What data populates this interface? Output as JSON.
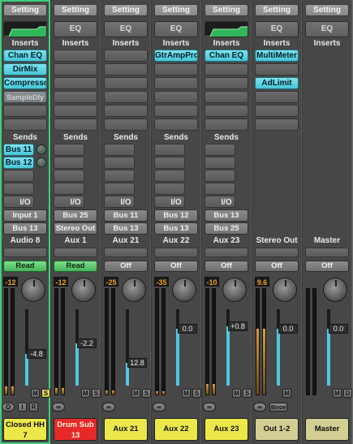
{
  "colors": {
    "accent_cyan": "#47c6d8",
    "read_green": "#49b35a",
    "selected_outline": "#3fd07a",
    "plate_yellow": "#ede84a",
    "plate_red": "#e62a2a",
    "plate_olive": "#d3cf94",
    "peak_orange": "#f0a020"
  },
  "section_labels": {
    "inserts": "Inserts",
    "sends": "Sends",
    "io": "I/O"
  },
  "strips": [
    {
      "setting": "Setting",
      "eq": "",
      "eq_visual": "curve",
      "inserts": [
        "Chan EQ",
        "DirMix",
        "Compresso",
        "SampleDly",
        "",
        ""
      ],
      "insert_states": [
        "on",
        "on",
        "on",
        "off",
        "empty",
        "empty"
      ],
      "sends": [
        "Bus 11",
        "Bus 12",
        "",
        "",
        ""
      ],
      "io_input": "Input 1",
      "io_output": "Bus 13",
      "track_label": "Audio 8",
      "automation": "Read",
      "peak": "-12",
      "fader_value": "-4.8",
      "fader_level": 0.42,
      "meter_level": 0.08,
      "buttons": [
        "M",
        "S"
      ],
      "bottom_buttons": [
        "O",
        "I",
        "R"
      ],
      "name_line1": "Closed HH",
      "name_line2": "7",
      "name_color": "yellow"
    },
    {
      "setting": "Setting",
      "eq": "EQ",
      "eq_visual": "empty",
      "inserts": [
        "",
        "",
        "",
        "",
        "",
        ""
      ],
      "insert_states": [
        "empty",
        "empty",
        "empty",
        "empty",
        "empty",
        "empty"
      ],
      "sends": [
        "",
        "",
        "",
        "",
        ""
      ],
      "io_input": "Bus 25",
      "io_output": "Stereo Out",
      "track_label": "Aux 1",
      "automation": "Read",
      "peak": "-12",
      "fader_value": "-2.2",
      "fader_level": 0.55,
      "meter_level": 0.06,
      "buttons": [
        "M",
        "S"
      ],
      "bottom_buttons": [
        "link"
      ],
      "name_line1": "Drum Sub",
      "name_line2": "13",
      "name_color": "red"
    },
    {
      "setting": "Setting",
      "eq": "EQ",
      "eq_visual": "empty",
      "inserts": [
        "",
        "",
        "",
        "",
        "",
        ""
      ],
      "insert_states": [
        "empty",
        "empty",
        "empty",
        "empty",
        "empty",
        "empty"
      ],
      "sends": [
        "",
        "",
        "",
        "",
        ""
      ],
      "io_input": "Bus 11",
      "io_output": "Bus 13",
      "track_label": "Aux 21",
      "automation": "Off",
      "peak": "-25",
      "fader_value": "12.8",
      "fader_level": 0.3,
      "meter_level": 0.04,
      "buttons": [
        "M",
        "S"
      ],
      "bottom_buttons": [
        "link"
      ],
      "name_line1": "Aux 21",
      "name_line2": "",
      "name_color": "yellow"
    },
    {
      "setting": "Setting",
      "eq": "EQ",
      "eq_visual": "empty",
      "inserts": [
        "GtrAmpPro",
        "",
        "",
        "",
        "",
        ""
      ],
      "insert_states": [
        "on",
        "empty",
        "empty",
        "empty",
        "empty",
        "empty"
      ],
      "sends": [
        "",
        "",
        "",
        "",
        ""
      ],
      "io_input": "Bus 12",
      "io_output": "Bus 13",
      "track_label": "Aux 22",
      "automation": "Off",
      "peak": "-35",
      "fader_value": "0.0",
      "fader_level": 0.75,
      "meter_level": 0.03,
      "buttons": [
        "M",
        "S"
      ],
      "bottom_buttons": [
        "link"
      ],
      "name_line1": "Aux 22",
      "name_line2": "",
      "name_color": "yellow"
    },
    {
      "setting": "Setting",
      "eq": "",
      "eq_visual": "curve",
      "inserts": [
        "Chan EQ",
        "",
        "",
        "",
        "",
        ""
      ],
      "insert_states": [
        "on",
        "empty",
        "empty",
        "empty",
        "empty",
        "empty"
      ],
      "sends": [
        "",
        "",
        "",
        "",
        ""
      ],
      "io_input": "Bus 13",
      "io_output": "Bus 25",
      "track_label": "Aux 23",
      "automation": "Off",
      "peak": "-10",
      "fader_value": "+0.8",
      "fader_level": 0.78,
      "meter_level": 0.1,
      "buttons": [
        "M",
        "S"
      ],
      "bottom_buttons": [
        "link"
      ],
      "name_line1": "Aux 23",
      "name_line2": "",
      "name_color": "yellow"
    },
    {
      "setting": "Setting",
      "eq": "EQ",
      "eq_visual": "empty",
      "inserts": [
        "MultiMeter",
        "",
        "AdLimit",
        "",
        "",
        ""
      ],
      "insert_states": [
        "on",
        "empty",
        "on",
        "empty",
        "empty",
        "empty"
      ],
      "sends": [],
      "io_input": "",
      "io_output": "",
      "track_label": "Stereo Out",
      "automation": "Off",
      "peak": "9.6",
      "fader_value": "0.0",
      "fader_level": 0.75,
      "meter_level": 0.62,
      "buttons": [
        "M"
      ],
      "bottom_buttons": [
        "link",
        "Bnce"
      ],
      "name_line1": "Out 1-2",
      "name_line2": "",
      "name_color": "olive"
    },
    {
      "setting": "Setting",
      "eq": "EQ",
      "eq_visual": "empty",
      "inserts": [],
      "insert_states": [],
      "sends": [],
      "io_input": "",
      "io_output": "",
      "track_label": "Master",
      "automation": "Off",
      "peak": "",
      "fader_value": "0.0",
      "fader_level": 0.75,
      "meter_level": 0.0,
      "buttons": [
        "M",
        "D"
      ],
      "bottom_buttons": [],
      "name_line1": "Master",
      "name_line2": "",
      "name_color": "olive"
    }
  ]
}
